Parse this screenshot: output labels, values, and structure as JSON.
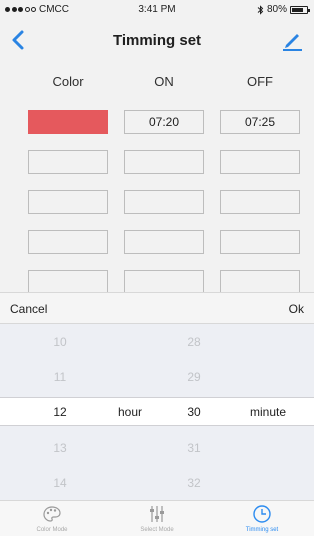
{
  "status_bar": {
    "carrier": "CMCC",
    "time": "3:41 PM",
    "battery": "80%",
    "battery_level": 0.8
  },
  "nav": {
    "title": "Timming set"
  },
  "table": {
    "headers": [
      "Color",
      "ON",
      "OFF"
    ],
    "rows": [
      {
        "color": "#f25e63",
        "on": "07:20",
        "off": "07:25"
      },
      {
        "color": "",
        "on": "",
        "off": ""
      },
      {
        "color": "",
        "on": "",
        "off": ""
      },
      {
        "color": "",
        "on": "",
        "off": ""
      },
      {
        "color": "",
        "on": "",
        "off": ""
      }
    ]
  },
  "picker": {
    "cancel_label": "Cancel",
    "ok_label": "Ok",
    "hours": [
      "10",
      "11",
      "12",
      "13",
      "14"
    ],
    "minutes": [
      "28",
      "29",
      "30",
      "31",
      "32"
    ],
    "selected_index": 2,
    "hour_label": "hour",
    "minute_label": "minute"
  },
  "tabs": [
    {
      "label": "Color Mode",
      "icon": "palette-icon",
      "active": false
    },
    {
      "label": "Select Mode",
      "icon": "sliders-icon",
      "active": false
    },
    {
      "label": "Timming set",
      "icon": "clock-icon",
      "active": true
    }
  ],
  "colors": {
    "accent": "#2d8cf0",
    "selected_color": "#f25e63"
  }
}
